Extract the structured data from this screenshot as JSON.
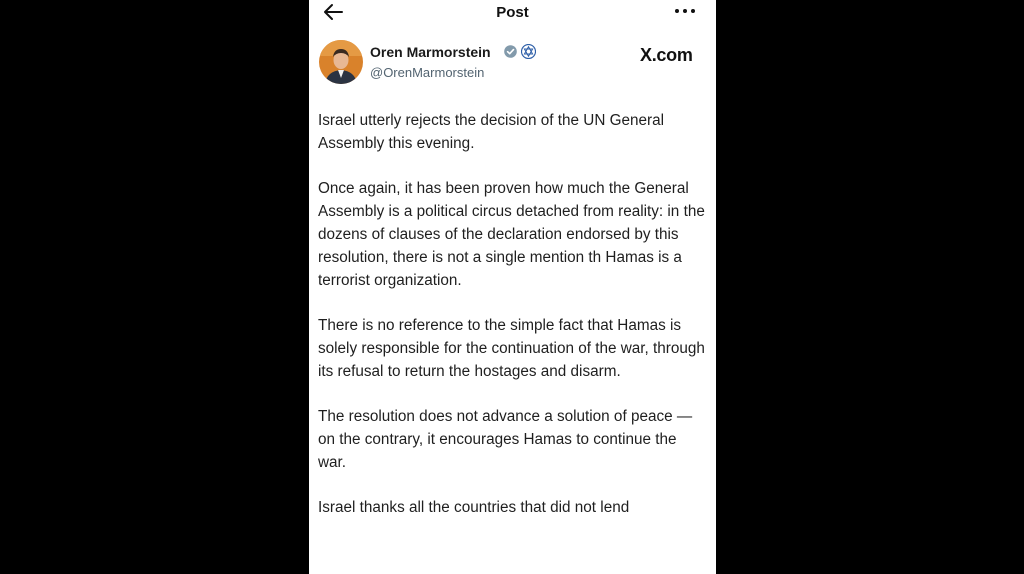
{
  "header": {
    "title": "Post",
    "back_icon": "arrow-left-icon",
    "more_icon": "more-horizontal-icon"
  },
  "author": {
    "name": "Oren Marmorstein",
    "handle": "@OrenMarmorstein",
    "verified_icon": "gray-verified-checkmark-icon",
    "affiliate_icon": "israel-emblem-badge-icon"
  },
  "source": "X.com",
  "post": {
    "paragraphs": [
      "Israel utterly rejects the decision of the UN General Assembly this evening.",
      "Once again, it has been proven how much the General Assembly is a political circus detached from reality: in the dozens of clauses of the declaration endorsed by this resolution, there is not a single mention th     Hamas is a terrorist organization.",
      "There is no reference to the simple fact that Hamas is solely responsible for the continuation of the war, through its refusal to return the hostages and disarm.",
      "The resolution does not advance a solution of peace — on the contrary, it encourages Hamas to continue the war.",
      "Israel thanks all the countries that did not lend"
    ]
  },
  "colors": {
    "background": "#000000",
    "card": "#ffffff",
    "text": "#1f1f1f",
    "secondary": "#536471"
  }
}
